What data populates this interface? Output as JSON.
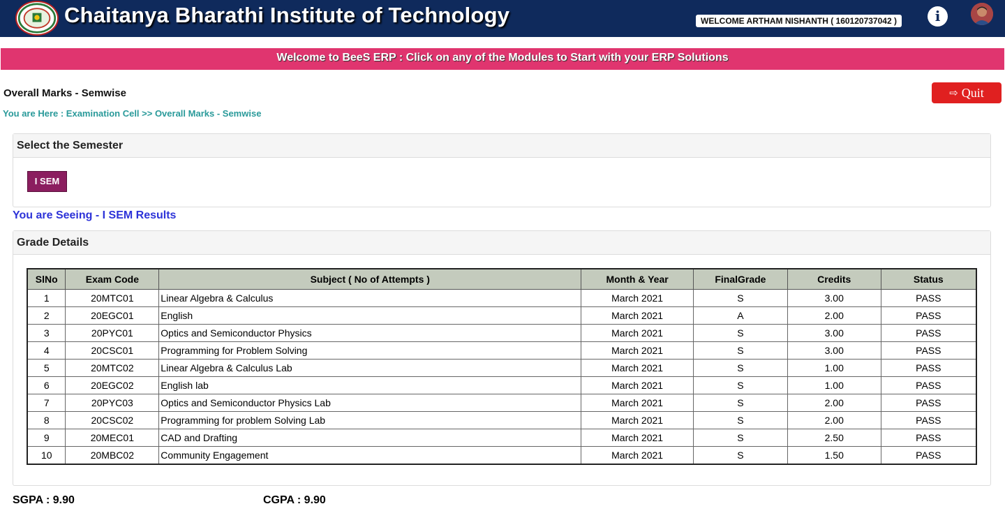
{
  "header": {
    "institute_name": "Chaitanya Bharathi Institute of Technology",
    "welcome_text": "WELCOME ARTHAM NISHANTH ( 160120737042 )",
    "info_icon": "info-icon",
    "info_glyph": "i",
    "avatar_icon": "user-avatar"
  },
  "banner": {
    "text": "Welcome to BeeS ERP : Click on any of the Modules to Start with your ERP Solutions"
  },
  "page": {
    "title": "Overall Marks - Semwise",
    "breadcrumb": "You are Here : Examination Cell >> Overall Marks - Semwise",
    "quit_label": "Quit",
    "quit_icon": "sign-out-icon",
    "quit_glyph": "⇨"
  },
  "semester_panel": {
    "heading": "Select the Semester",
    "button_label": "I SEM"
  },
  "seeing_text": "You are Seeing - I SEM Results",
  "grade_panel": {
    "heading": "Grade Details",
    "columns": [
      "SlNo",
      "Exam Code",
      "Subject ( No of Attempts )",
      "Month & Year",
      "FinalGrade",
      "Credits",
      "Status"
    ],
    "rows": [
      {
        "slno": "1",
        "code": "20MTC01",
        "subject": "Linear Algebra & Calculus",
        "month_year": "March 2021",
        "grade": "S",
        "credits": "3.00",
        "status": "PASS"
      },
      {
        "slno": "2",
        "code": "20EGC01",
        "subject": "English",
        "month_year": "March 2021",
        "grade": "A",
        "credits": "2.00",
        "status": "PASS"
      },
      {
        "slno": "3",
        "code": "20PYC01",
        "subject": "Optics and Semiconductor Physics",
        "month_year": "March 2021",
        "grade": "S",
        "credits": "3.00",
        "status": "PASS"
      },
      {
        "slno": "4",
        "code": "20CSC01",
        "subject": "Programming for Problem Solving",
        "month_year": "March 2021",
        "grade": "S",
        "credits": "3.00",
        "status": "PASS"
      },
      {
        "slno": "5",
        "code": "20MTC02",
        "subject": "Linear Algebra & Calculus Lab",
        "month_year": "March 2021",
        "grade": "S",
        "credits": "1.00",
        "status": "PASS"
      },
      {
        "slno": "6",
        "code": "20EGC02",
        "subject": "English lab",
        "month_year": "March 2021",
        "grade": "S",
        "credits": "1.00",
        "status": "PASS"
      },
      {
        "slno": "7",
        "code": "20PYC03",
        "subject": "Optics and Semiconductor Physics Lab",
        "month_year": "March 2021",
        "grade": "S",
        "credits": "2.00",
        "status": "PASS"
      },
      {
        "slno": "8",
        "code": "20CSC02",
        "subject": "Programming for problem Solving Lab",
        "month_year": "March 2021",
        "grade": "S",
        "credits": "2.00",
        "status": "PASS"
      },
      {
        "slno": "9",
        "code": "20MEC01",
        "subject": "CAD and Drafting",
        "month_year": "March 2021",
        "grade": "S",
        "credits": "2.50",
        "status": "PASS"
      },
      {
        "slno": "10",
        "code": "20MBC02",
        "subject": "Community Engagement",
        "month_year": "March 2021",
        "grade": "S",
        "credits": "1.50",
        "status": "PASS"
      }
    ]
  },
  "summary": {
    "sgpa": "SGPA : 9.90",
    "cgpa": "CGPA : 9.90"
  },
  "colors": {
    "header_bg": "#0f2a5c",
    "banner_bg": "#e0356f",
    "quit_bg": "#e02020",
    "sem_button_bg": "#8b1e5f",
    "seeing_text": "#2d33d8",
    "breadcrumb_text": "#2a9a9a",
    "table_header_bg": "#c4cbbd"
  }
}
